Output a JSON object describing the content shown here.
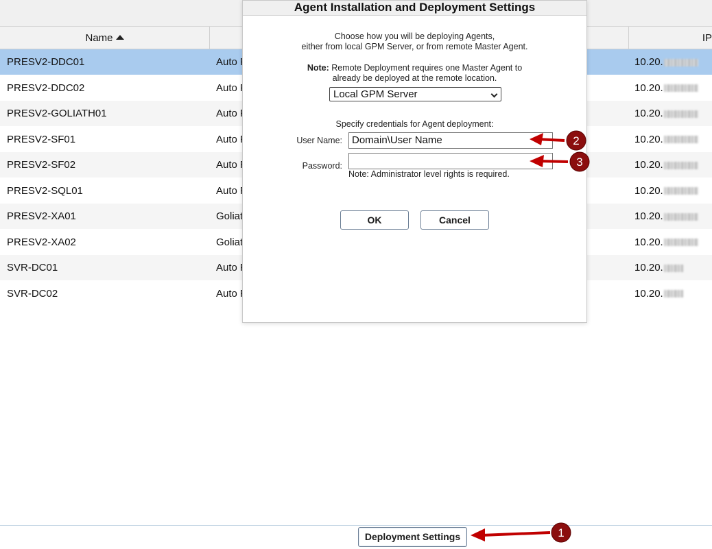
{
  "table": {
    "columns": {
      "name": "Name",
      "ip": "IP"
    },
    "rows": [
      {
        "name": "PRESV2-DDC01",
        "type": "Auto F",
        "ip": "10.20.",
        "selected": true
      },
      {
        "name": "PRESV2-DDC02",
        "type": "Auto F",
        "ip": "10.20."
      },
      {
        "name": "PRESV2-GOLIATH01",
        "type": "Auto F",
        "ip": "10.20."
      },
      {
        "name": "PRESV2-SF01",
        "type": "Auto F",
        "ip": "10.20."
      },
      {
        "name": "PRESV2-SF02",
        "type": "Auto F",
        "ip": "10.20."
      },
      {
        "name": "PRESV2-SQL01",
        "type": "Auto F",
        "ip": "10.20."
      },
      {
        "name": "PRESV2-XA01",
        "type": "Goliat",
        "ip": "10.20."
      },
      {
        "name": "PRESV2-XA02",
        "type": "Goliat",
        "ip": "10.20."
      },
      {
        "name": "SVR-DC01",
        "type": "Auto F",
        "ip": "10.20."
      },
      {
        "name": "SVR-DC02",
        "type": "Auto F",
        "ip": "10.20."
      }
    ]
  },
  "dialog": {
    "title": "Agent Installation and Deployment Settings",
    "intro_line1": "Choose how you will be deploying Agents,",
    "intro_line2": "either from local GPM Server, or from remote Master Agent.",
    "note_label": "Note:",
    "note_line1": "Remote Deployment requires one Master Agent to",
    "note_line2": "already be deployed at the remote location.",
    "deployment_source": "Local GPM Server",
    "credentials_label": "Specify credentials for Agent deployment:",
    "user_label": "User Name:",
    "user_value": "Domain\\User Name",
    "password_label": "Password:",
    "password_value": "",
    "hint": "Note: Administrator level rights is required.",
    "ok_label": "OK",
    "cancel_label": "Cancel"
  },
  "footer": {
    "deployment_settings_label": "Deployment Settings"
  },
  "callouts": [
    {
      "number": "1"
    },
    {
      "number": "2"
    },
    {
      "number": "3"
    }
  ],
  "colors": {
    "selected_row": "#a9cbee",
    "callout_red": "#c00000",
    "badge_fill": "#8b0e0e"
  }
}
